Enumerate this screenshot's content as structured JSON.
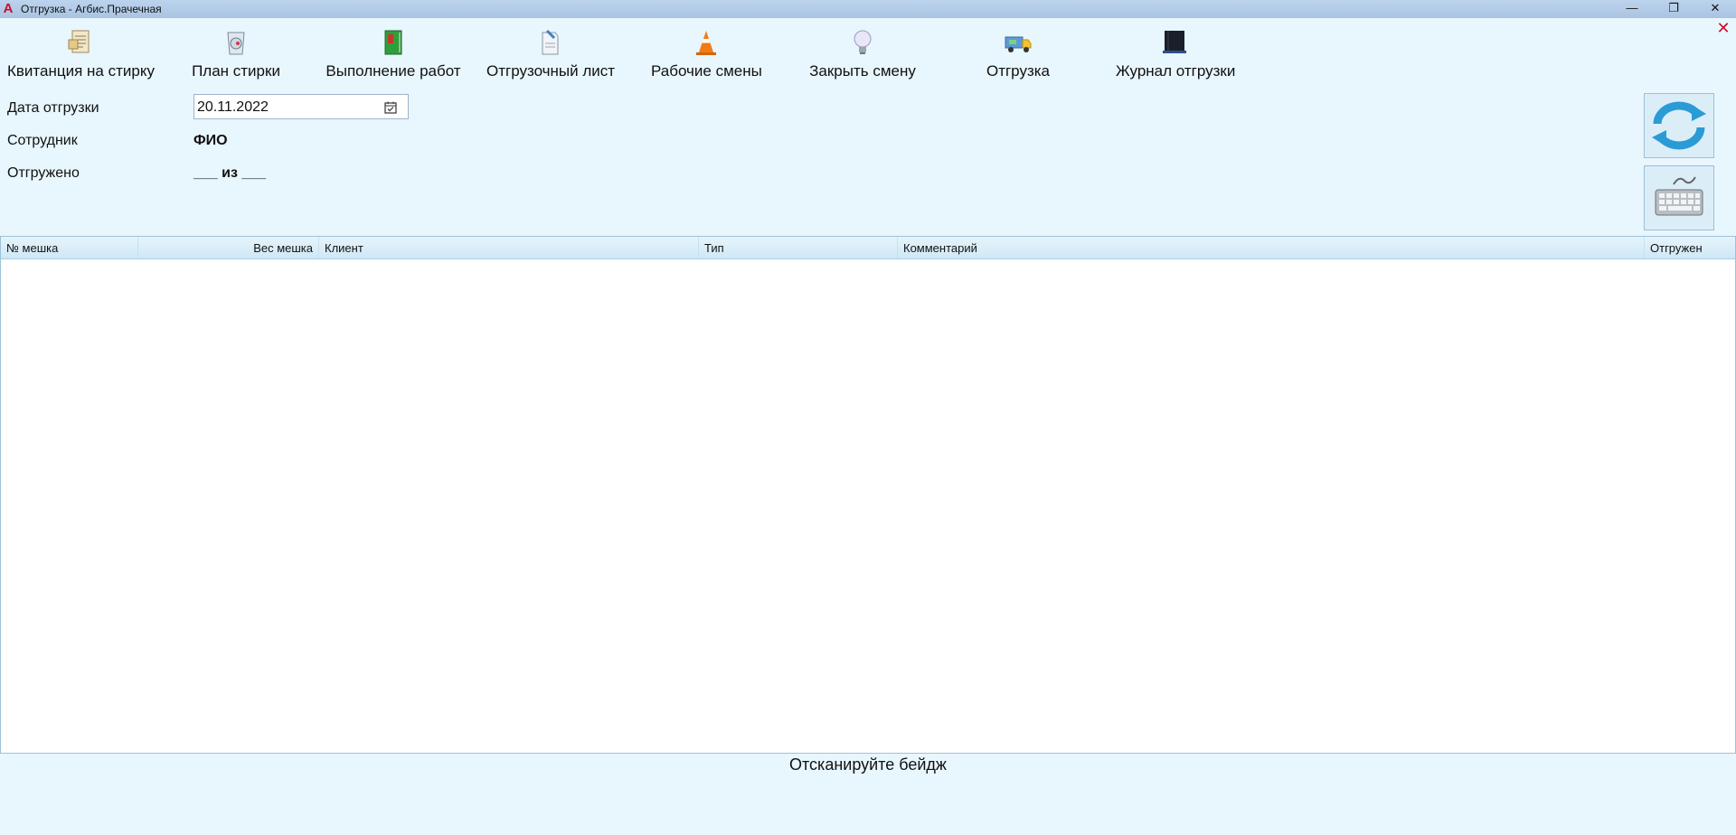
{
  "window": {
    "title": "Отгрузка - Агбис.Прачечная",
    "logo_letter": "A",
    "minimize": "—",
    "restore": "❐",
    "close": "✕"
  },
  "close_form": "✕",
  "toolbar": [
    {
      "label": "Квитанция на стирку",
      "icon": "receipt-icon"
    },
    {
      "label": "План стирки",
      "icon": "wash-plan-icon"
    },
    {
      "label": "Выполнение работ",
      "icon": "green-book-icon"
    },
    {
      "label": "Отгрузочный лист",
      "icon": "shipping-sheet-icon"
    },
    {
      "label": "Рабочие смены",
      "icon": "traffic-cone-icon"
    },
    {
      "label": "Закрыть смену",
      "icon": "lightbulb-icon"
    },
    {
      "label": "Отгрузка",
      "icon": "delivery-truck-icon"
    },
    {
      "label": "Журнал отгрузки",
      "icon": "black-journal-icon"
    }
  ],
  "form": {
    "date_label": "Дата отгрузки",
    "date_value": "20.11.2022",
    "employee_label": "Сотрудник",
    "employee_value": "ФИО",
    "shipped_label": "Отгружено",
    "shipped_value": "___ из ___"
  },
  "side_buttons": [
    "refresh-icon",
    "keyboard-icon"
  ],
  "table": {
    "columns": [
      "№ мешка",
      "Вес мешка",
      "Клиент",
      "Тип",
      "Комментарий",
      "Отгружен"
    ],
    "rows": []
  },
  "status_text": "Отсканируйте бейдж"
}
